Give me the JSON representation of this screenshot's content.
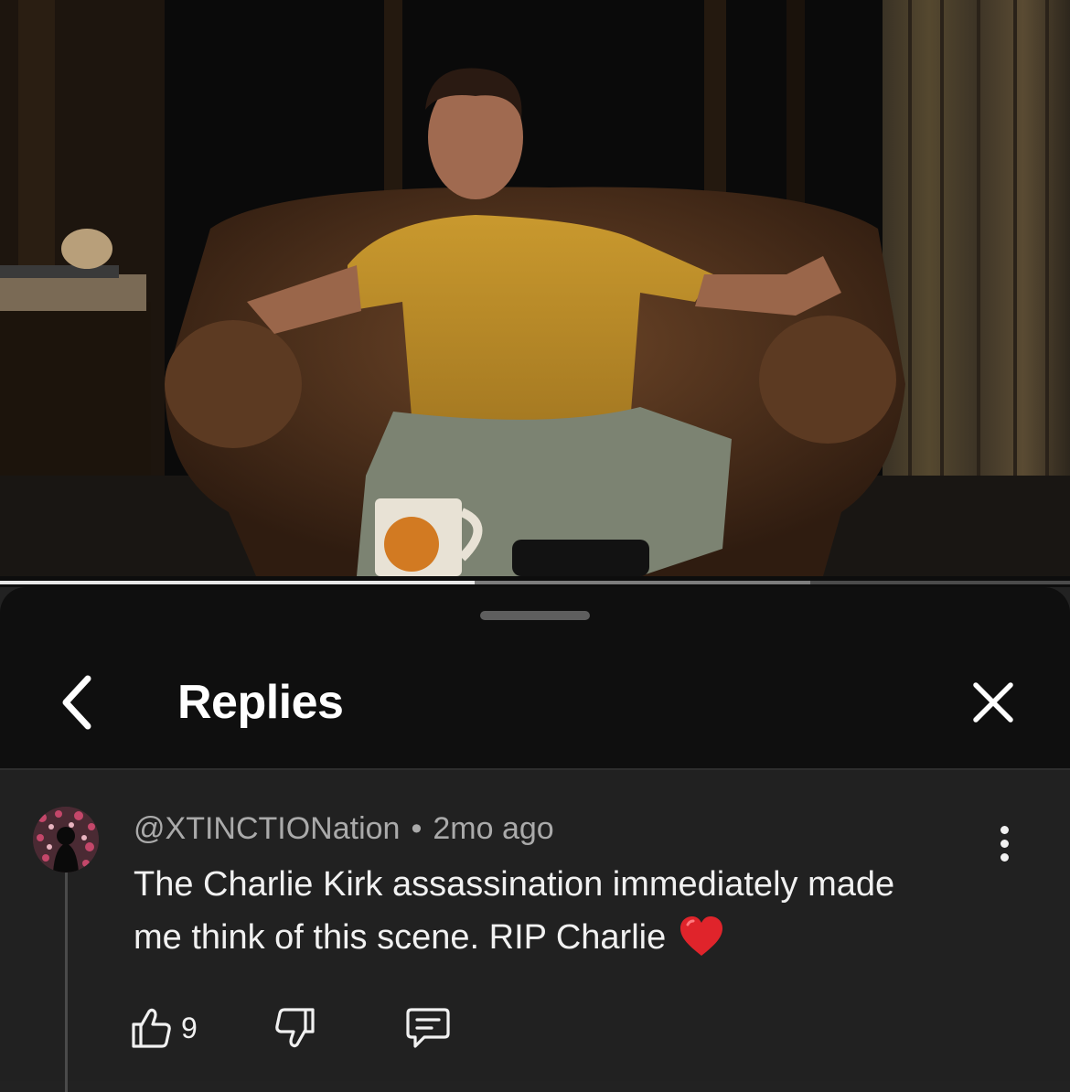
{
  "video": {
    "progress_fraction": 0.444,
    "buffer_fraction": 0.757
  },
  "sheet": {
    "title": "Replies",
    "back_icon": "chevron-left-icon",
    "close_icon": "close-icon"
  },
  "comment": {
    "author": "@XTINCTIONation",
    "separator": "•",
    "time": "2mo ago",
    "text": "The Charlie Kirk assassination immediately made me think of this scene. RIP Charlie",
    "emoji": "❤️",
    "like_count": "9",
    "icons": {
      "like": "thumbs-up-icon",
      "dislike": "thumbs-down-icon",
      "reply": "reply-comment-icon",
      "more": "more-vertical-icon"
    }
  },
  "colors": {
    "sheet_background": "#0f0f0f",
    "comment_background": "#212121",
    "secondary_text": "#aaaaaa",
    "heart": "#e0242b"
  }
}
